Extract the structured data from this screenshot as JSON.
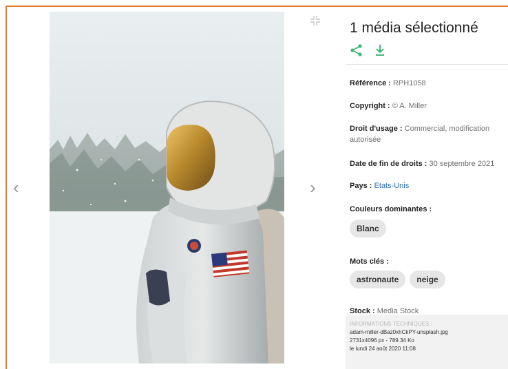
{
  "navigation": {
    "prev_icon": "chevron-left-icon",
    "next_icon": "chevron-right-icon",
    "prev_glyph": "‹",
    "next_glyph": "›",
    "collapse_icon": "collapse-icon"
  },
  "header": {
    "title": "1 média sélectionné",
    "actions": [
      {
        "icon": "share-icon",
        "color": "#3cb878"
      },
      {
        "icon": "download-icon",
        "color": "#3cb878"
      }
    ]
  },
  "details": {
    "reference": {
      "label": "Référence :",
      "value": "RPH1058"
    },
    "copyright": {
      "label": "Copyright :",
      "value": "© A. Miller"
    },
    "usage": {
      "label": "Droit d'usage :",
      "value": "Commercial, modification autorisée"
    },
    "end_date": {
      "label": "Date de fin de droits :",
      "value": "30 septembre 2021"
    },
    "country": {
      "label": "Pays :",
      "value": "Etats-Unis"
    },
    "colors": {
      "label": "Couleurs dominantes :",
      "tags": [
        "Blanc"
      ]
    },
    "keywords": {
      "label": "Mots clés :",
      "tags": [
        "astronaute",
        "neige"
      ]
    },
    "stock": {
      "label": "Stock :",
      "value": "Media Stock"
    }
  },
  "technical": {
    "heading": "INFORMATIONS TECHNIQUES :",
    "filename": "adam-miller-dBaz0xhCkPY-unsplash.jpg",
    "dimensions": "2731x4096 px - 789.34 Ko",
    "date": "le lundi 24 août 2020 11:08"
  },
  "colors": {
    "accent_border": "#e07b39",
    "action_green": "#3cb878",
    "link_blue": "#2a6fb0"
  }
}
